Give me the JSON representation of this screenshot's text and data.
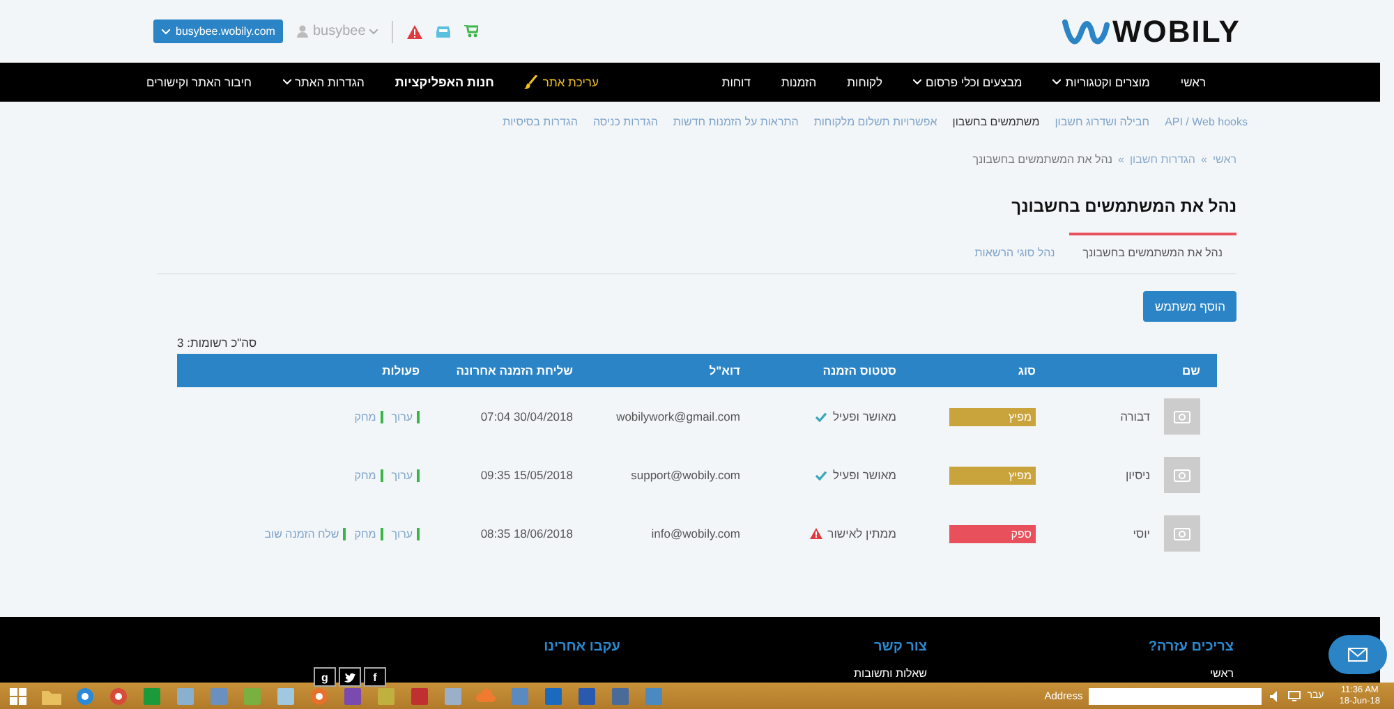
{
  "header": {
    "logo": "WOBILY",
    "site_button": "busybee.wobily.com",
    "user": "busybee"
  },
  "nav": {
    "main": [
      {
        "label": "ראשי",
        "kind": "plain"
      },
      {
        "label": "מוצרים וקטגוריות",
        "kind": "dropdown"
      },
      {
        "label": "מבצעים וכלי פרסום",
        "kind": "dropdown"
      },
      {
        "label": "לקוחות",
        "kind": "plain"
      },
      {
        "label": "הזמנות",
        "kind": "plain"
      },
      {
        "label": "דוחות",
        "kind": "plain"
      }
    ],
    "side": [
      {
        "label": "עריכת אתר",
        "kind": "edit"
      },
      {
        "label": "חנות האפליקציות",
        "kind": "bold"
      },
      {
        "label": "הגדרות האתר",
        "kind": "dropdown"
      },
      {
        "label": "חיבור האתר וקישורים",
        "kind": "plain"
      }
    ]
  },
  "subnav": [
    {
      "label": "API / Web hooks",
      "selected": false
    },
    {
      "label": "חבילה ושדרוג חשבון",
      "selected": false
    },
    {
      "label": "משתמשים בחשבון",
      "selected": true
    },
    {
      "label": "אפשרויות תשלום מלקוחות",
      "selected": false
    },
    {
      "label": "התראות על הזמנות חדשות",
      "selected": false
    },
    {
      "label": "הגדרות כניסה",
      "selected": false
    },
    {
      "label": "הגדרות בסיסיות",
      "selected": false
    }
  ],
  "breadcrumb": {
    "separator": "»",
    "items": [
      "ראשי",
      "הגדרות חשבון",
      "נהל את המשתמשים בחשבונך"
    ]
  },
  "title": "נהל את המשתמשים בחשבונך",
  "tabs": [
    {
      "label": "נהל את המשתמשים בחשבונך",
      "selected": true
    },
    {
      "label": "נהל סוגי הרשאות",
      "selected": false
    }
  ],
  "add_button": "הוסף משתמש",
  "total": "סה\"כ רשומות: 3",
  "table": {
    "columns": [
      "שם",
      "סוג",
      "סטטוס הזמנה",
      "דוא\"ל",
      "שליחת הזמנה אחרונה",
      "פעולות"
    ],
    "rows": [
      {
        "name": "דבורה",
        "type": "מפיץ",
        "color": "#c9a43c",
        "status": "מאושר ופעיל",
        "kind": "approved",
        "email": "wobilywork@gmail.com",
        "last_sent": "07:04 30/04/2018",
        "actions": [
          "ערוך",
          "מחק"
        ]
      },
      {
        "name": "ניסיון",
        "type": "מפיץ",
        "color": "#c9a43c",
        "status": "מאושר ופעיל",
        "kind": "approved",
        "email": "support@wobily.com",
        "last_sent": "09:35 15/05/2018",
        "actions": [
          "ערוך",
          "מחק"
        ]
      },
      {
        "name": "יוסי",
        "type": "ספק",
        "color": "#e8505b",
        "status": "ממתין לאישור",
        "kind": "pending",
        "email": "info@wobily.com",
        "last_sent": "08:35 18/06/2018",
        "actions": [
          "ערוך",
          "מחק",
          "שלח הזמנה שוב"
        ]
      }
    ]
  },
  "footer": {
    "columns": [
      {
        "title": "צריכים עזרה?",
        "links": [
          "ראשי"
        ]
      },
      {
        "title": "צור קשר",
        "links": [
          "שאלות ותשובות"
        ]
      },
      {
        "title": "עקבו אחרינו"
      }
    ],
    "social": [
      {
        "kind": "text",
        "label": "f"
      },
      {
        "kind": "bird"
      },
      {
        "kind": "text",
        "label": "g"
      }
    ]
  },
  "taskbar": {
    "address_label": "Address",
    "language": "עבר",
    "time": "11:36 AM",
    "date": "18-Jun-18"
  }
}
